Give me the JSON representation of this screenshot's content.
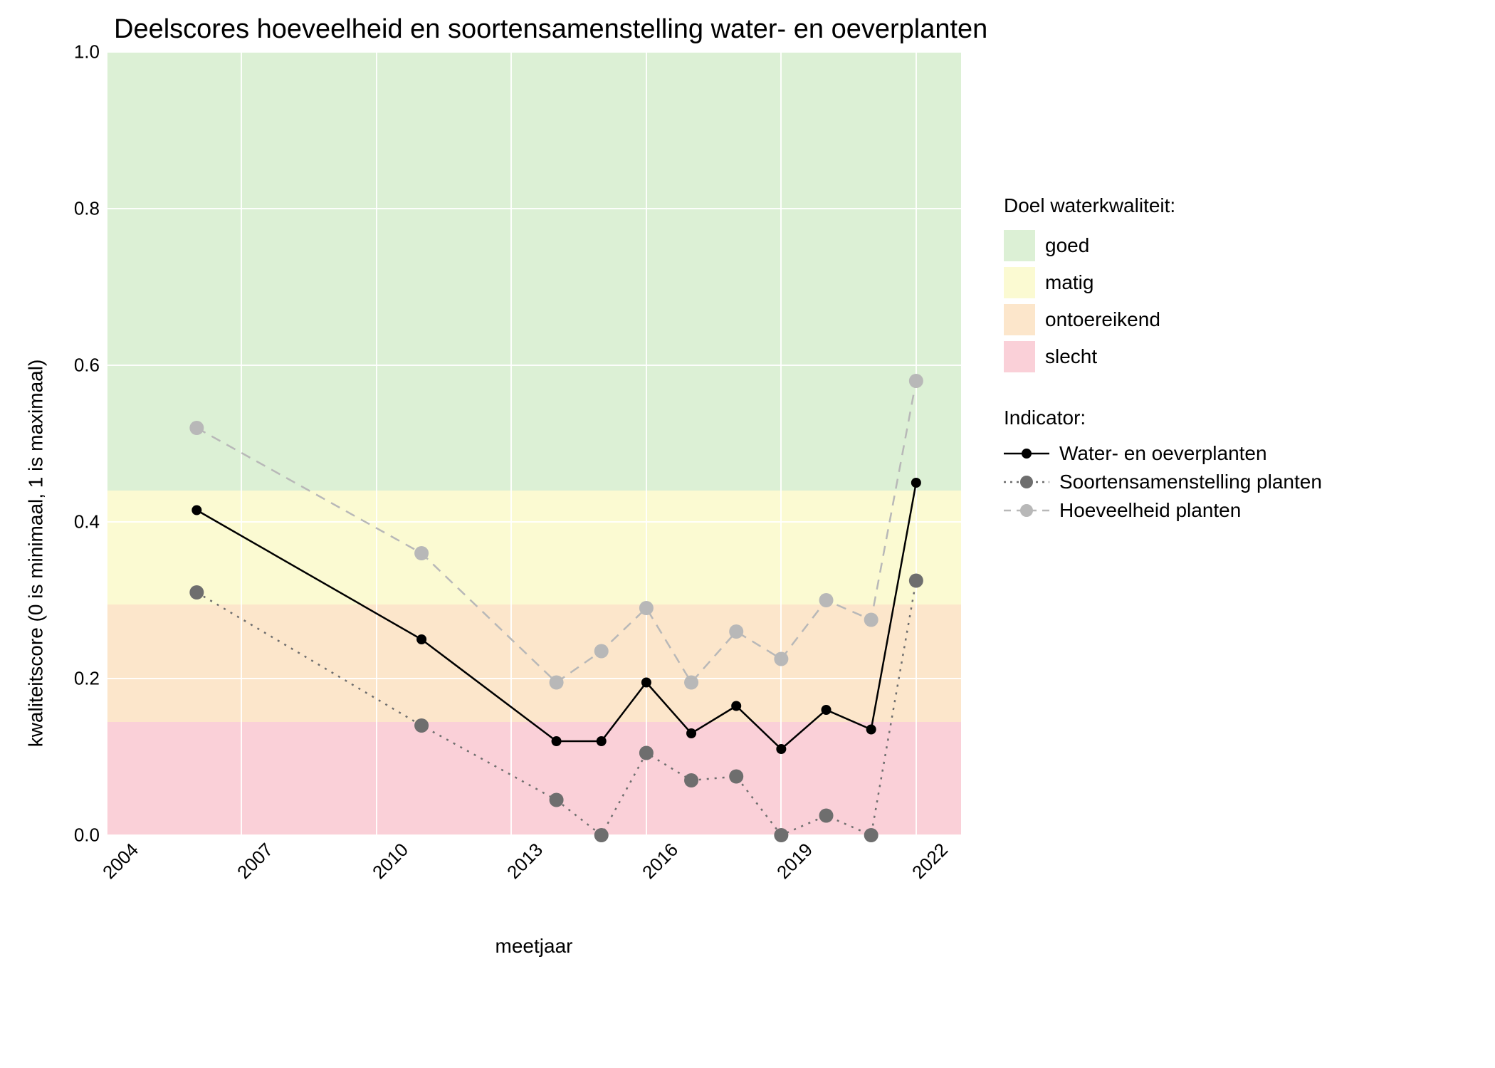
{
  "title": "Deelscores hoeveelheid en soortensamenstelling water- en oeverplanten",
  "xlabel": "meetjaar",
  "ylabel": "kwaliteitscore (0 is minimaal, 1 is maximaal)",
  "legend": {
    "bands_title": "Doel waterkwaliteit:",
    "bands": {
      "goed": "goed",
      "matig": "matig",
      "ontoereikend": "ontoereikend",
      "slecht": "slecht"
    },
    "series_title": "Indicator:",
    "series": {
      "wo": "Water- en oeverplanten",
      "ss": "Soortensamenstelling planten",
      "hp": "Hoeveelheid planten"
    }
  },
  "xticks": [
    "2004",
    "2007",
    "2010",
    "2013",
    "2016",
    "2019",
    "2022"
  ],
  "yticks": [
    "0.0",
    "0.2",
    "0.4",
    "0.6",
    "0.8",
    "1.0"
  ],
  "chart_data": {
    "type": "line",
    "title": "Deelscores hoeveelheid en soortensamenstelling water- en oeverplanten",
    "xlabel": "meetjaar",
    "ylabel": "kwaliteitscore (0 is minimaal, 1 is maximaal)",
    "xlim": [
      2004,
      2023
    ],
    "ylim": [
      0.0,
      1.0
    ],
    "bands": [
      {
        "name": "slecht",
        "from": 0.0,
        "to": 0.145,
        "color": "#fad0d8"
      },
      {
        "name": "ontoereikend",
        "from": 0.145,
        "to": 0.295,
        "color": "#fce6cb"
      },
      {
        "name": "matig",
        "from": 0.295,
        "to": 0.44,
        "color": "#fbfad2"
      },
      {
        "name": "goed",
        "from": 0.44,
        "to": 1.0,
        "color": "#dcf0d5"
      }
    ],
    "x": [
      2006,
      2011,
      2014,
      2015,
      2016,
      2017,
      2018,
      2019,
      2020,
      2021,
      2022
    ],
    "series": [
      {
        "name": "Water- en oeverplanten",
        "color": "#000000",
        "dash": "solid",
        "values": [
          0.415,
          0.25,
          0.12,
          0.12,
          0.195,
          0.13,
          0.165,
          0.11,
          0.16,
          0.135,
          0.45
        ]
      },
      {
        "name": "Soortensamenstelling planten",
        "color": "#6e6e6e",
        "dash": "dotted",
        "values": [
          0.31,
          0.14,
          0.045,
          0.0,
          0.105,
          0.07,
          0.075,
          0.0,
          0.025,
          0.0,
          0.325
        ]
      },
      {
        "name": "Hoeveelheid planten",
        "color": "#b8b8b8",
        "dash": "dashed",
        "values": [
          0.52,
          0.36,
          0.195,
          0.235,
          0.29,
          0.195,
          0.26,
          0.225,
          0.3,
          0.275,
          0.58
        ]
      }
    ]
  }
}
